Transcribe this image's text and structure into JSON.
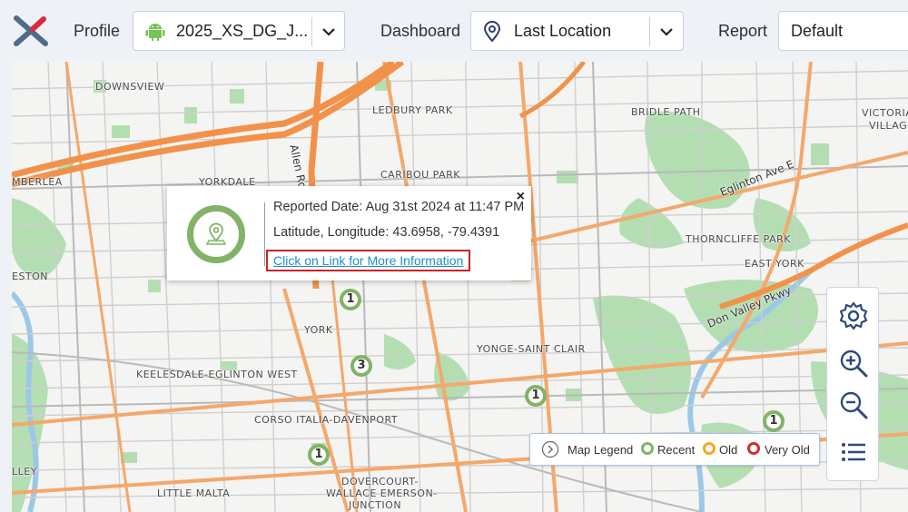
{
  "header": {
    "profile_label": "Profile",
    "profile_value": "2025_XS_DG_J...",
    "dashboard_label": "Dashboard",
    "dashboard_value": "Last Location",
    "report_label": "Report",
    "report_value": "Default"
  },
  "map": {
    "places": [
      "DOWNSVIEW",
      "LEDBURY PARK",
      "BRIDLE PATH",
      "VICTORIA",
      "VILLAGE",
      "YORKDALE",
      "CARIBOU PARK",
      "MBERLEA",
      "THORNCLIFFE PARK",
      "EAST YORK",
      "ESTON",
      "YORK",
      "YONGE-SAINT CLAIR",
      "KEELESDALE-EGLINTON WEST",
      "CORSO ITALIA-DAVENPORT",
      "DOVERCOURT-",
      "WALLACE EMERSON-",
      "JUNCTION",
      "LITTLE MALTA",
      "LLEY"
    ],
    "streets": [
      "Allen Rd",
      "Eglinton Ave E",
      "Don Valley Pkwy"
    ],
    "markers": [
      {
        "count": "1",
        "status": "recent"
      },
      {
        "count": "3",
        "status": "recent"
      },
      {
        "count": "1",
        "status": "recent"
      },
      {
        "count": "1",
        "status": "recent"
      },
      {
        "count": "1",
        "status": "recent"
      }
    ]
  },
  "popup": {
    "icon": "location-pin-icon",
    "reported_date": "Reported Date: Aug 31st 2024 at 11:47 PM",
    "lat_lng": "Latitude, Longitude: 43.6958, -79.4391",
    "link": "Click on Link for More Information",
    "close": "×"
  },
  "legend": {
    "title": "Map Legend",
    "recent": "Recent",
    "old": "Old",
    "very_old": "Very Old",
    "colors": {
      "recent": "#82b366",
      "old": "#f5a623",
      "very_old": "#d0312d"
    }
  },
  "controls": [
    "settings-icon",
    "zoom-in-icon",
    "zoom-out-icon",
    "menu-icon"
  ]
}
